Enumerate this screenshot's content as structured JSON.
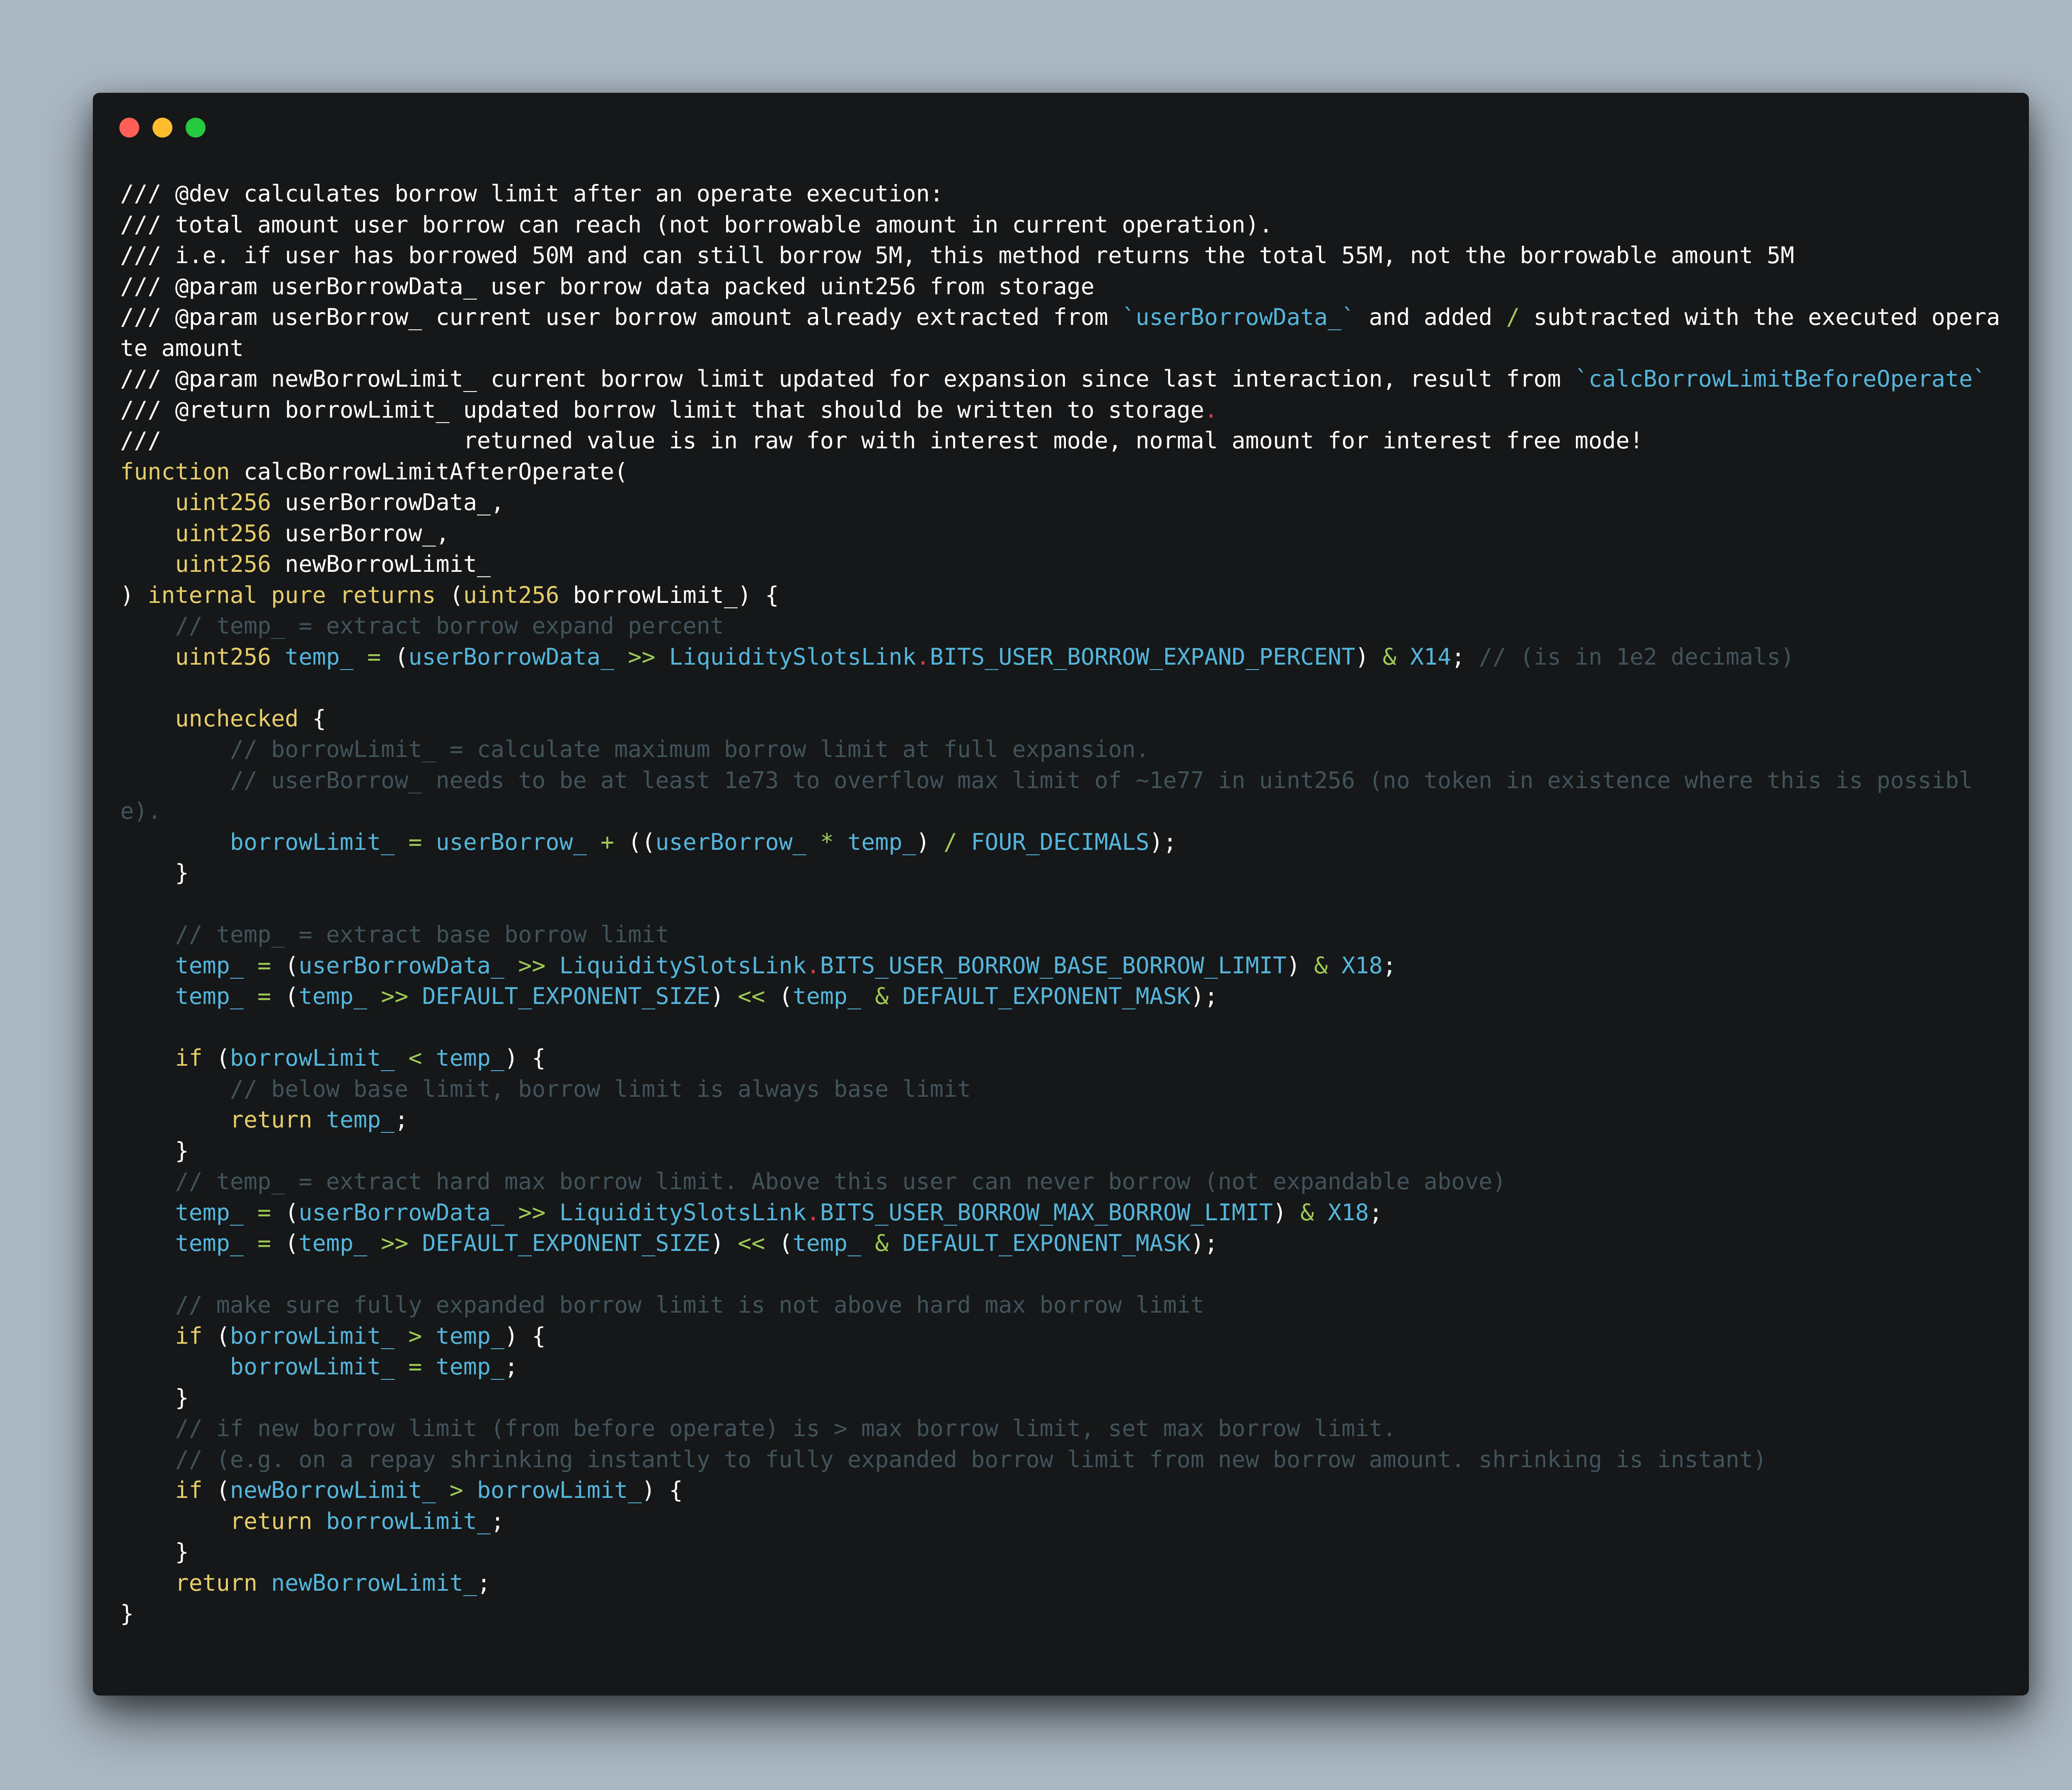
{
  "window": {
    "controls": {
      "close_color": "#ff5f56",
      "minimize_color": "#ffbd2e",
      "zoom_color": "#27c93f"
    }
  },
  "theme": {
    "background": "#abb8c3",
    "editor_background": "#151718",
    "colors": {
      "keyword": "#e6cd69",
      "identifier": "#55b5db",
      "operator": "#9fca56",
      "comment": "#41535b",
      "plain": "#ffffff",
      "accent_red": "#cd3f45"
    }
  },
  "code": {
    "language": "solidity",
    "lines": [
      [
        [
          "pl",
          "/// @dev calculates borrow limit after an operate execution:"
        ]
      ],
      [
        [
          "pl",
          "/// total amount user borrow can reach (not borrowable amount in current operation)."
        ]
      ],
      [
        [
          "pl",
          "/// i.e. if user has borrowed 50M and can still borrow 5M, this method returns the total 55M, not the borrowable amount 5M"
        ]
      ],
      [
        [
          "pl",
          "/// @param userBorrowData_ user borrow data packed uint256 from storage"
        ]
      ],
      [
        [
          "pl",
          "/// @param userBorrow_ current user borrow amount already extracted from "
        ],
        [
          "tk",
          "`userBorrowData_`"
        ],
        [
          "pl",
          " and added "
        ],
        [
          "op",
          "/"
        ],
        [
          "pl",
          " subtracted with the executed operate amount"
        ]
      ],
      [
        [
          "pl",
          "/// @param newBorrowLimit_ current borrow limit updated for expansion since last interaction, result from "
        ],
        [
          "tk",
          "`calcBorrowLimitBeforeOperate`"
        ]
      ],
      [
        [
          "pl",
          "/// @return borrowLimit_ updated borrow limit that should be written to storage"
        ],
        [
          "red",
          "."
        ]
      ],
      [
        [
          "pl",
          "///                      returned value is in raw for with interest mode, normal amount for interest free mode!"
        ]
      ],
      [
        [
          "kw",
          "function"
        ],
        [
          "pl",
          " calcBorrowLimitAfterOperate("
        ]
      ],
      [
        [
          "pl",
          "    "
        ],
        [
          "kw",
          "uint256"
        ],
        [
          "pl",
          " userBorrowData_,"
        ]
      ],
      [
        [
          "pl",
          "    "
        ],
        [
          "kw",
          "uint256"
        ],
        [
          "pl",
          " userBorrow_,"
        ]
      ],
      [
        [
          "pl",
          "    "
        ],
        [
          "kw",
          "uint256"
        ],
        [
          "pl",
          " newBorrowLimit_"
        ]
      ],
      [
        [
          "pl",
          ") "
        ],
        [
          "kw",
          "internal"
        ],
        [
          "pl",
          " "
        ],
        [
          "kw",
          "pure"
        ],
        [
          "pl",
          " "
        ],
        [
          "kw",
          "returns"
        ],
        [
          "pl",
          " ("
        ],
        [
          "kw",
          "uint256"
        ],
        [
          "pl",
          " borrowLimit_) {"
        ]
      ],
      [
        [
          "pl",
          "    "
        ],
        [
          "cm",
          "// temp_ = extract borrow expand percent"
        ]
      ],
      [
        [
          "pl",
          "    "
        ],
        [
          "kw",
          "uint256"
        ],
        [
          "pl",
          " "
        ],
        [
          "id",
          "temp_"
        ],
        [
          "pl",
          " "
        ],
        [
          "op",
          "="
        ],
        [
          "pl",
          " ("
        ],
        [
          "id",
          "userBorrowData_"
        ],
        [
          "pl",
          " "
        ],
        [
          "op",
          ">>"
        ],
        [
          "pl",
          " "
        ],
        [
          "id",
          "LiquiditySlotsLink"
        ],
        [
          "red",
          "."
        ],
        [
          "id",
          "BITS_USER_BORROW_EXPAND_PERCENT"
        ],
        [
          "pl",
          ") "
        ],
        [
          "op",
          "&"
        ],
        [
          "pl",
          " "
        ],
        [
          "id",
          "X14"
        ],
        [
          "pl",
          "; "
        ],
        [
          "cm",
          "// (is in 1e2 decimals)"
        ]
      ],
      [
        [
          "pl",
          ""
        ]
      ],
      [
        [
          "pl",
          "    "
        ],
        [
          "kw",
          "unchecked"
        ],
        [
          "pl",
          " {"
        ]
      ],
      [
        [
          "pl",
          "        "
        ],
        [
          "cm",
          "// borrowLimit_ = calculate maximum borrow limit at full expansion."
        ]
      ],
      [
        [
          "pl",
          "        "
        ],
        [
          "cm",
          "// userBorrow_ needs to be at least 1e73 to overflow max limit of ~1e77 in uint256 (no token in existence where this is possible)."
        ]
      ],
      [
        [
          "pl",
          "        "
        ],
        [
          "id",
          "borrowLimit_"
        ],
        [
          "pl",
          " "
        ],
        [
          "op",
          "="
        ],
        [
          "pl",
          " "
        ],
        [
          "id",
          "userBorrow_"
        ],
        [
          "pl",
          " "
        ],
        [
          "op",
          "+"
        ],
        [
          "pl",
          " (("
        ],
        [
          "id",
          "userBorrow_"
        ],
        [
          "pl",
          " "
        ],
        [
          "op",
          "*"
        ],
        [
          "pl",
          " "
        ],
        [
          "id",
          "temp_"
        ],
        [
          "pl",
          ") "
        ],
        [
          "op",
          "/"
        ],
        [
          "pl",
          " "
        ],
        [
          "id",
          "FOUR_DECIMALS"
        ],
        [
          "pl",
          ");"
        ]
      ],
      [
        [
          "pl",
          "    }"
        ]
      ],
      [
        [
          "pl",
          ""
        ]
      ],
      [
        [
          "pl",
          "    "
        ],
        [
          "cm",
          "// temp_ = extract base borrow limit"
        ]
      ],
      [
        [
          "pl",
          "    "
        ],
        [
          "id",
          "temp_"
        ],
        [
          "pl",
          " "
        ],
        [
          "op",
          "="
        ],
        [
          "pl",
          " ("
        ],
        [
          "id",
          "userBorrowData_"
        ],
        [
          "pl",
          " "
        ],
        [
          "op",
          ">>"
        ],
        [
          "pl",
          " "
        ],
        [
          "id",
          "LiquiditySlotsLink"
        ],
        [
          "red",
          "."
        ],
        [
          "id",
          "BITS_USER_BORROW_BASE_BORROW_LIMIT"
        ],
        [
          "pl",
          ") "
        ],
        [
          "op",
          "&"
        ],
        [
          "pl",
          " "
        ],
        [
          "id",
          "X18"
        ],
        [
          "pl",
          ";"
        ]
      ],
      [
        [
          "pl",
          "    "
        ],
        [
          "id",
          "temp_"
        ],
        [
          "pl",
          " "
        ],
        [
          "op",
          "="
        ],
        [
          "pl",
          " ("
        ],
        [
          "id",
          "temp_"
        ],
        [
          "pl",
          " "
        ],
        [
          "op",
          ">>"
        ],
        [
          "pl",
          " "
        ],
        [
          "id",
          "DEFAULT_EXPONENT_SIZE"
        ],
        [
          "pl",
          ") "
        ],
        [
          "op",
          "<<"
        ],
        [
          "pl",
          " ("
        ],
        [
          "id",
          "temp_"
        ],
        [
          "pl",
          " "
        ],
        [
          "op",
          "&"
        ],
        [
          "pl",
          " "
        ],
        [
          "id",
          "DEFAULT_EXPONENT_MASK"
        ],
        [
          "pl",
          ");"
        ]
      ],
      [
        [
          "pl",
          ""
        ]
      ],
      [
        [
          "pl",
          "    "
        ],
        [
          "kw",
          "if"
        ],
        [
          "pl",
          " ("
        ],
        [
          "id",
          "borrowLimit_"
        ],
        [
          "pl",
          " "
        ],
        [
          "op",
          "<"
        ],
        [
          "pl",
          " "
        ],
        [
          "id",
          "temp_"
        ],
        [
          "pl",
          ") {"
        ]
      ],
      [
        [
          "pl",
          "        "
        ],
        [
          "cm",
          "// below base limit, borrow limit is always base limit"
        ]
      ],
      [
        [
          "pl",
          "        "
        ],
        [
          "kw",
          "return"
        ],
        [
          "pl",
          " "
        ],
        [
          "id",
          "temp_"
        ],
        [
          "pl",
          ";"
        ]
      ],
      [
        [
          "pl",
          "    }"
        ]
      ],
      [
        [
          "pl",
          "    "
        ],
        [
          "cm",
          "// temp_ = extract hard max borrow limit. Above this user can never borrow (not expandable above)"
        ]
      ],
      [
        [
          "pl",
          "    "
        ],
        [
          "id",
          "temp_"
        ],
        [
          "pl",
          " "
        ],
        [
          "op",
          "="
        ],
        [
          "pl",
          " ("
        ],
        [
          "id",
          "userBorrowData_"
        ],
        [
          "pl",
          " "
        ],
        [
          "op",
          ">>"
        ],
        [
          "pl",
          " "
        ],
        [
          "id",
          "LiquiditySlotsLink"
        ],
        [
          "red",
          "."
        ],
        [
          "id",
          "BITS_USER_BORROW_MAX_BORROW_LIMIT"
        ],
        [
          "pl",
          ") "
        ],
        [
          "op",
          "&"
        ],
        [
          "pl",
          " "
        ],
        [
          "id",
          "X18"
        ],
        [
          "pl",
          ";"
        ]
      ],
      [
        [
          "pl",
          "    "
        ],
        [
          "id",
          "temp_"
        ],
        [
          "pl",
          " "
        ],
        [
          "op",
          "="
        ],
        [
          "pl",
          " ("
        ],
        [
          "id",
          "temp_"
        ],
        [
          "pl",
          " "
        ],
        [
          "op",
          ">>"
        ],
        [
          "pl",
          " "
        ],
        [
          "id",
          "DEFAULT_EXPONENT_SIZE"
        ],
        [
          "pl",
          ") "
        ],
        [
          "op",
          "<<"
        ],
        [
          "pl",
          " ("
        ],
        [
          "id",
          "temp_"
        ],
        [
          "pl",
          " "
        ],
        [
          "op",
          "&"
        ],
        [
          "pl",
          " "
        ],
        [
          "id",
          "DEFAULT_EXPONENT_MASK"
        ],
        [
          "pl",
          ");"
        ]
      ],
      [
        [
          "pl",
          ""
        ]
      ],
      [
        [
          "pl",
          "    "
        ],
        [
          "cm",
          "// make sure fully expanded borrow limit is not above hard max borrow limit"
        ]
      ],
      [
        [
          "pl",
          "    "
        ],
        [
          "kw",
          "if"
        ],
        [
          "pl",
          " ("
        ],
        [
          "id",
          "borrowLimit_"
        ],
        [
          "pl",
          " "
        ],
        [
          "op",
          ">"
        ],
        [
          "pl",
          " "
        ],
        [
          "id",
          "temp_"
        ],
        [
          "pl",
          ") {"
        ]
      ],
      [
        [
          "pl",
          "        "
        ],
        [
          "id",
          "borrowLimit_"
        ],
        [
          "pl",
          " "
        ],
        [
          "op",
          "="
        ],
        [
          "pl",
          " "
        ],
        [
          "id",
          "temp_"
        ],
        [
          "pl",
          ";"
        ]
      ],
      [
        [
          "pl",
          "    }"
        ]
      ],
      [
        [
          "pl",
          "    "
        ],
        [
          "cm",
          "// if new borrow limit (from before operate) is > max borrow limit, set max borrow limit."
        ]
      ],
      [
        [
          "pl",
          "    "
        ],
        [
          "cm",
          "// (e.g. on a repay shrinking instantly to fully expanded borrow limit from new borrow amount. shrinking is instant)"
        ]
      ],
      [
        [
          "pl",
          "    "
        ],
        [
          "kw",
          "if"
        ],
        [
          "pl",
          " ("
        ],
        [
          "id",
          "newBorrowLimit_"
        ],
        [
          "pl",
          " "
        ],
        [
          "op",
          ">"
        ],
        [
          "pl",
          " "
        ],
        [
          "id",
          "borrowLimit_"
        ],
        [
          "pl",
          ") {"
        ]
      ],
      [
        [
          "pl",
          "        "
        ],
        [
          "kw",
          "return"
        ],
        [
          "pl",
          " "
        ],
        [
          "id",
          "borrowLimit_"
        ],
        [
          "pl",
          ";"
        ]
      ],
      [
        [
          "pl",
          "    }"
        ]
      ],
      [
        [
          "pl",
          "    "
        ],
        [
          "kw",
          "return"
        ],
        [
          "pl",
          " "
        ],
        [
          "id",
          "newBorrowLimit_"
        ],
        [
          "pl",
          ";"
        ]
      ],
      [
        [
          "pl",
          "}"
        ]
      ]
    ]
  }
}
